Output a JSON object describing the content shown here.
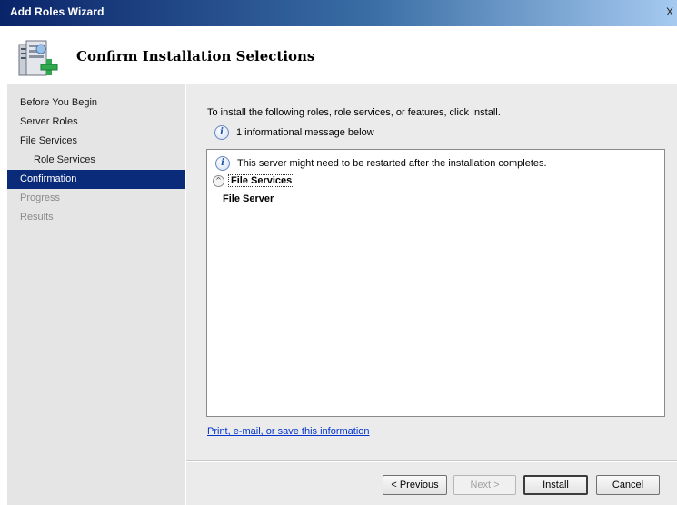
{
  "window": {
    "title": "Add Roles Wizard",
    "close_label": "X"
  },
  "header": {
    "title": "Confirm Installation Selections",
    "icon": "server-add-role-icon"
  },
  "sidebar": {
    "items": [
      {
        "label": "Before You Begin",
        "state": "normal"
      },
      {
        "label": "Server Roles",
        "state": "normal"
      },
      {
        "label": "File Services",
        "state": "normal"
      },
      {
        "label": "Role Services",
        "state": "normal"
      },
      {
        "label": "Confirmation",
        "state": "selected"
      },
      {
        "label": "Progress",
        "state": "disabled"
      },
      {
        "label": "Results",
        "state": "disabled"
      }
    ]
  },
  "main": {
    "intro": "To install the following roles, role services, or features, click Install.",
    "info_message": "1 informational message below",
    "details": {
      "restart_message": "This server might need to be restarted after the installation completes.",
      "section_title": "File Services",
      "section_item": "File Server"
    },
    "print_link": "Print, e-mail, or save this information"
  },
  "buttons": {
    "previous": "< Previous",
    "next": "Next >",
    "install": "Install",
    "cancel": "Cancel"
  },
  "colors": {
    "selected_nav": "#0a2a7a",
    "link": "#0033cc",
    "titlebar_start": "#0a246a"
  }
}
